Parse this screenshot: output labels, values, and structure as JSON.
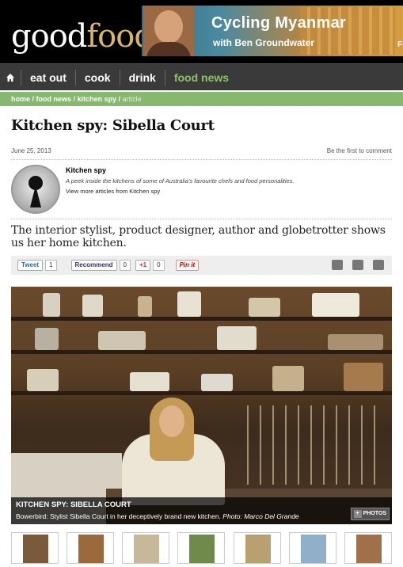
{
  "header": {
    "logo_good": "good",
    "logo_food": "food",
    "banner_title": "Cycling Myanmar",
    "banner_subtitle": "with Ben Groundwater",
    "banner_cut": "FI"
  },
  "nav": {
    "home_icon": "home-icon",
    "items": [
      {
        "label": "eat out",
        "active": false
      },
      {
        "label": "cook",
        "active": false
      },
      {
        "label": "drink",
        "active": false
      },
      {
        "label": "food news",
        "active": true
      }
    ],
    "accent": "#8dc26d"
  },
  "breadcrumb": [
    "home",
    "food news",
    "kitchen spy",
    "article"
  ],
  "article": {
    "title": "Kitchen spy: Sibella Court",
    "date": "June 25, 2013",
    "comment_link": "Be the first to comment",
    "author": {
      "name": "Kitchen spy",
      "description": "A peek inside the kitchens of some of Australia's favourite chefs and food personalities.",
      "more_link": "View more articles from Kitchen spy"
    },
    "intro": "The interior stylist, product designer, author and globetrotter shows us her home kitchen."
  },
  "social": {
    "tweet_label": "Tweet",
    "tweet_count": "1",
    "recommend_label": "Recommend",
    "recommend_count": "0",
    "gplus_label": "+1",
    "gplus_count": "0",
    "pin_label": "Pin it",
    "tools": [
      "email-icon",
      "print-icon",
      "share-icon"
    ]
  },
  "photo": {
    "caption_title": "KITCHEN SPY: SIBELLA COURT",
    "caption_text": "Bowerbird: Stylist Sibella Court in her deceptively brand new kitchen.",
    "caption_credit": "Photo: Marco Del Grande",
    "photos_button": "PHOTOS"
  },
  "thumbnails": [
    {
      "color": "#7a5a3a"
    },
    {
      "color": "#9b6a3c"
    },
    {
      "color": "#c8b89a"
    },
    {
      "color": "#6f8a4a"
    },
    {
      "color": "#b8a070"
    },
    {
      "color": "#8fb0c8"
    },
    {
      "color": "#a0704a"
    }
  ]
}
